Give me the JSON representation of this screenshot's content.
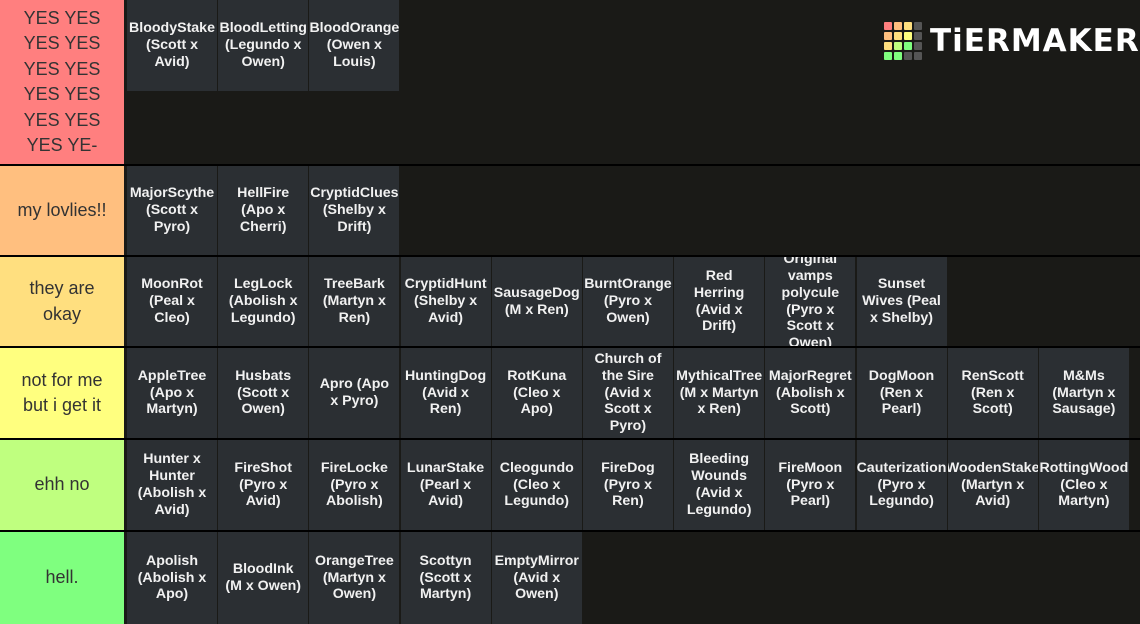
{
  "logo": {
    "text": "TiERMAKER",
    "grid_colors": [
      "#ff7f7f",
      "#ffbf7f",
      "#ffdf7f",
      "#555555",
      "#ffbf7f",
      "#ffdf7f",
      "#ffff7f",
      "#555555",
      "#ffdf7f",
      "#bfff7f",
      "#7fff7f",
      "#555555",
      "#7fff7f",
      "#7fff7f",
      "#555555",
      "#555555"
    ]
  },
  "tiers": [
    {
      "label": "YES YES\nYES YES\nYES YES\nYES YES\nYES YES\nYES YE-",
      "color": "#ff7f7f",
      "items": [
        "BloodyStake\n(Scott x\nAvid)",
        "BloodLetting\n(Legundo x\nOwen)",
        "BloodOrange\n(Owen x\nLouis)"
      ]
    },
    {
      "label": "my lovlies!!",
      "color": "#ffbf7f",
      "items": [
        "MajorScythe\n(Scott x\nPyro)",
        "HellFire\n(Apo x\nCherri)",
        "CryptidClues\n(Shelby x\nDrift)"
      ]
    },
    {
      "label": "they are\nokay",
      "color": "#ffdf7f",
      "items": [
        "MoonRot\n(Peal x\nCleo)",
        "LegLock\n(Abolish x\nLegundo)",
        "TreeBark\n(Martyn x\nRen)",
        "CryptidHunt\n(Shelby x\nAvid)",
        "SausageDog\n(M x Ren)",
        "BurntOrange\n(Pyro x\nOwen)",
        "Red\nHerring\n(Avid x\nDrift)",
        "Original\nvamps\npolycule\n(Pyro x\nScott x\nOwen)",
        "Sunset\nWives (Peal\nx Shelby)"
      ]
    },
    {
      "label": "not for me\nbut i get it",
      "color": "#ffff7f",
      "items": [
        "AppleTree\n(Apo x\nMartyn)",
        "Husbats\n(Scott x\nOwen)",
        "Apro (Apo\nx Pyro)",
        "HuntingDog\n(Avid x\nRen)",
        "RotKuna\n(Cleo x\nApo)",
        "Church of\nthe Sire\n(Avid x\nScott x\nPyro)",
        "MythicalTree\n(M x Martyn\nx Ren)",
        "MajorRegret\n(Abolish x\nScott)",
        "DogMoon\n(Ren x\nPearl)",
        "RenScott\n(Ren x\nScott)",
        "M&Ms\n(Martyn x\nSausage)"
      ]
    },
    {
      "label": "ehh no",
      "color": "#bfff7f",
      "items": [
        "Hunter x\nHunter\n(Abolish x\nAvid)",
        "FireShot\n(Pyro x\nAvid)",
        "FireLocke\n(Pyro x\nAbolish)",
        "LunarStake\n(Pearl x\nAvid)",
        "Cleogundo\n(Cleo x\nLegundo)",
        "FireDog\n(Pyro x\nRen)",
        "Bleeding\nWounds\n(Avid x\nLegundo)",
        "FireMoon\n(Pyro x\nPearl)",
        "Cauterization\n(Pyro x\nLegundo)",
        "WoodenStake\n(Martyn x\nAvid)",
        "RottingWood\n(Cleo x\nMartyn)"
      ]
    },
    {
      "label": "hell.",
      "color": "#7fff7f",
      "items": [
        "Apolish\n(Abolish x\nApo)",
        "BloodInk\n(M x Owen)",
        "OrangeTree\n(Martyn x\nOwen)",
        "Scottyn\n(Scott x\nMartyn)",
        "EmptyMirror\n(Avid x\nOwen)"
      ]
    }
  ]
}
